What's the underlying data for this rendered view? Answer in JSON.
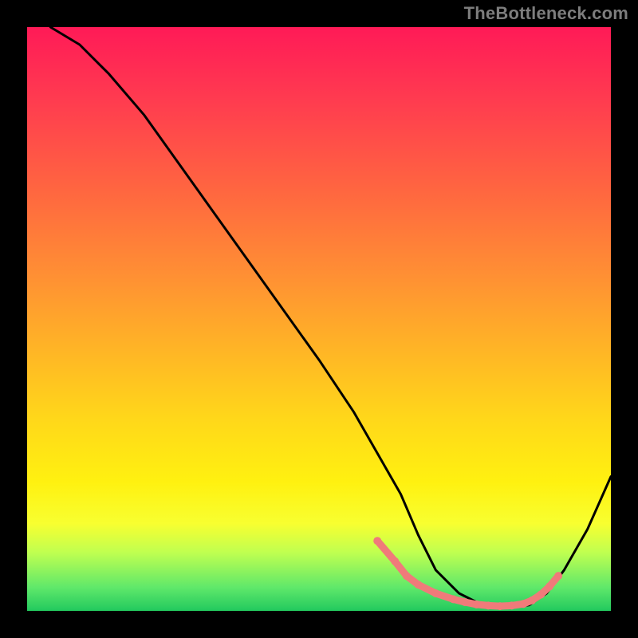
{
  "watermark": "TheBottleneck.com",
  "chart_data": {
    "type": "line",
    "title": "",
    "xlabel": "",
    "ylabel": "",
    "xlim": [
      0,
      100
    ],
    "ylim": [
      0,
      100
    ],
    "grid": false,
    "series": [
      {
        "name": "bottleneck-curve",
        "x": [
          4,
          9,
          14,
          20,
          30,
          40,
          50,
          56,
          60,
          64,
          67,
          70,
          74,
          78,
          82,
          86,
          89,
          92,
          96,
          100
        ],
        "y": [
          100,
          97,
          92,
          85,
          71,
          57,
          43,
          34,
          27,
          20,
          13,
          7,
          3,
          1,
          0.5,
          1,
          3,
          7,
          14,
          23
        ]
      }
    ],
    "markers": {
      "name": "highlighted-segment",
      "color": "#f07a7a",
      "x": [
        60,
        63,
        65,
        67,
        70,
        73,
        75,
        77,
        79,
        81,
        83,
        85,
        86.5,
        88,
        89.5,
        91
      ],
      "y": [
        12,
        8.5,
        6,
        4.5,
        3,
        2,
        1.5,
        1.1,
        0.9,
        0.8,
        0.9,
        1.2,
        1.8,
        2.8,
        4.2,
        6
      ]
    }
  }
}
